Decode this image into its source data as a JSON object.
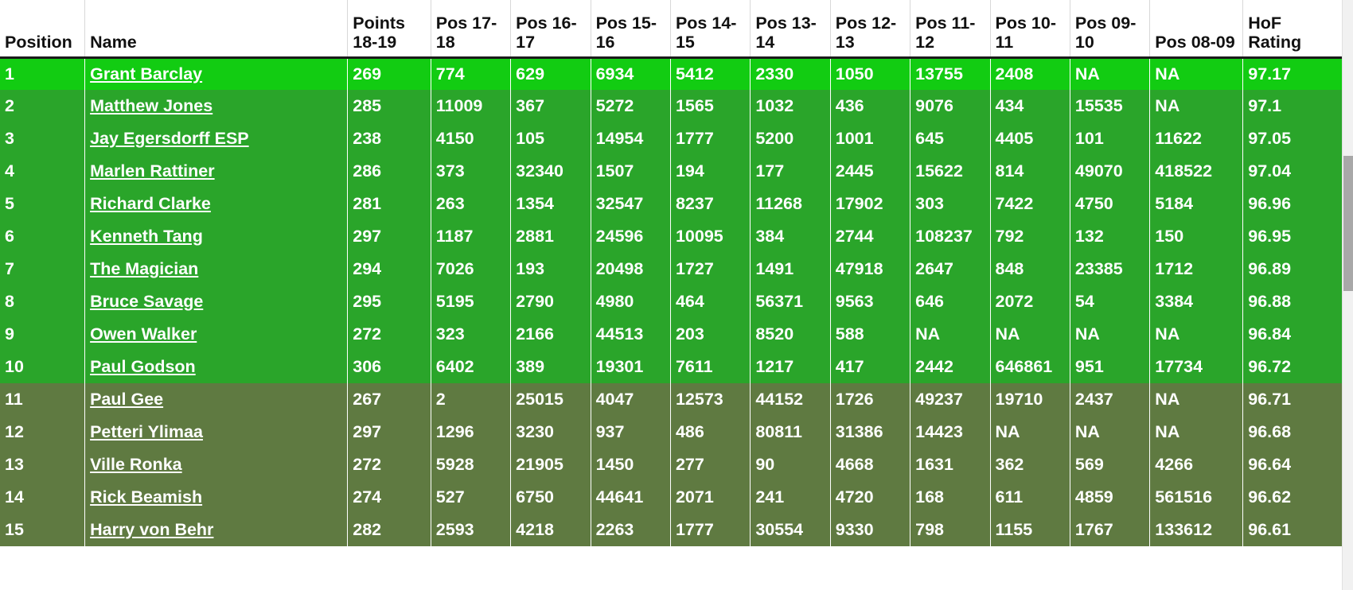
{
  "table": {
    "columns": [
      {
        "key": "position",
        "label": "Position"
      },
      {
        "key": "name",
        "label": "Name"
      },
      {
        "key": "points1819",
        "label": "Points 18-19"
      },
      {
        "key": "pos1718",
        "label": "Pos 17-18"
      },
      {
        "key": "pos1617",
        "label": "Pos 16-17"
      },
      {
        "key": "pos1516",
        "label": "Pos 15-16"
      },
      {
        "key": "pos1415",
        "label": "Pos 14-15"
      },
      {
        "key": "pos1314",
        "label": "Pos 13-14"
      },
      {
        "key": "pos1213",
        "label": "Pos 12-13"
      },
      {
        "key": "pos1112",
        "label": "Pos 11-12"
      },
      {
        "key": "pos1011",
        "label": "Pos 10-11"
      },
      {
        "key": "pos0910",
        "label": "Pos 09-10"
      },
      {
        "key": "pos0809",
        "label": "Pos 08-09"
      },
      {
        "key": "hof",
        "label": "HoF Rating"
      }
    ],
    "rows": [
      {
        "position": "1",
        "name": "Grant Barclay",
        "points1819": "269",
        "pos1718": "774",
        "pos1617": "629",
        "pos1516": "6934",
        "pos1415": "5412",
        "pos1314": "2330",
        "pos1213": "1050",
        "pos1112": "13755",
        "pos1011": "2408",
        "pos0910": "NA",
        "pos0809": "NA",
        "hof": "97.17",
        "tier": "top"
      },
      {
        "position": "2",
        "name": "Matthew Jones",
        "points1819": "285",
        "pos1718": "11009",
        "pos1617": "367",
        "pos1516": "5272",
        "pos1415": "1565",
        "pos1314": "1032",
        "pos1213": "436",
        "pos1112": "9076",
        "pos1011": "434",
        "pos0910": "15535",
        "pos0809": "NA",
        "hof": "97.1",
        "tier": "green"
      },
      {
        "position": "3",
        "name": "Jay Egersdorff ESP",
        "points1819": "238",
        "pos1718": "4150",
        "pos1617": "105",
        "pos1516": "14954",
        "pos1415": "1777",
        "pos1314": "5200",
        "pos1213": "1001",
        "pos1112": "645",
        "pos1011": "4405",
        "pos0910": "101",
        "pos0809": "11622",
        "hof": "97.05",
        "tier": "green"
      },
      {
        "position": "4",
        "name": "Marlen Rattiner",
        "points1819": "286",
        "pos1718": "373",
        "pos1617": "32340",
        "pos1516": "1507",
        "pos1415": "194",
        "pos1314": "177",
        "pos1213": "2445",
        "pos1112": "15622",
        "pos1011": "814",
        "pos0910": "49070",
        "pos0809": "418522",
        "hof": "97.04",
        "tier": "green"
      },
      {
        "position": "5",
        "name": "Richard Clarke",
        "points1819": "281",
        "pos1718": "263",
        "pos1617": "1354",
        "pos1516": "32547",
        "pos1415": "8237",
        "pos1314": "11268",
        "pos1213": "17902",
        "pos1112": "303",
        "pos1011": "7422",
        "pos0910": "4750",
        "pos0809": "5184",
        "hof": "96.96",
        "tier": "green"
      },
      {
        "position": "6",
        "name": "Kenneth Tang",
        "points1819": "297",
        "pos1718": "1187",
        "pos1617": "2881",
        "pos1516": "24596",
        "pos1415": "10095",
        "pos1314": "384",
        "pos1213": "2744",
        "pos1112": "108237",
        "pos1011": "792",
        "pos0910": "132",
        "pos0809": "150",
        "hof": "96.95",
        "tier": "green"
      },
      {
        "position": "7",
        "name": "The Magician",
        "points1819": "294",
        "pos1718": "7026",
        "pos1617": "193",
        "pos1516": "20498",
        "pos1415": "1727",
        "pos1314": "1491",
        "pos1213": "47918",
        "pos1112": "2647",
        "pos1011": "848",
        "pos0910": "23385",
        "pos0809": "1712",
        "hof": "96.89",
        "tier": "green"
      },
      {
        "position": "8",
        "name": "Bruce Savage",
        "points1819": "295",
        "pos1718": "5195",
        "pos1617": "2790",
        "pos1516": "4980",
        "pos1415": "464",
        "pos1314": "56371",
        "pos1213": "9563",
        "pos1112": "646",
        "pos1011": "2072",
        "pos0910": "54",
        "pos0809": "3384",
        "hof": "96.88",
        "tier": "green"
      },
      {
        "position": "9",
        "name": "Owen Walker",
        "points1819": "272",
        "pos1718": "323",
        "pos1617": "2166",
        "pos1516": "44513",
        "pos1415": "203",
        "pos1314": "8520",
        "pos1213": "588",
        "pos1112": "NA",
        "pos1011": "NA",
        "pos0910": "NA",
        "pos0809": "NA",
        "hof": "96.84",
        "tier": "green"
      },
      {
        "position": "10",
        "name": "Paul Godson",
        "points1819": "306",
        "pos1718": "6402",
        "pos1617": "389",
        "pos1516": "19301",
        "pos1415": "7611",
        "pos1314": "1217",
        "pos1213": "417",
        "pos1112": "2442",
        "pos1011": "646861",
        "pos0910": "951",
        "pos0809": "17734",
        "hof": "96.72",
        "tier": "green"
      },
      {
        "position": "11",
        "name": "Paul Gee",
        "points1819": "267",
        "pos1718": "2",
        "pos1617": "25015",
        "pos1516": "4047",
        "pos1415": "12573",
        "pos1314": "44152",
        "pos1213": "1726",
        "pos1112": "49237",
        "pos1011": "19710",
        "pos0910": "2437",
        "pos0809": "NA",
        "hof": "96.71",
        "tier": "olive"
      },
      {
        "position": "12",
        "name": "Petteri Ylimaa",
        "points1819": "297",
        "pos1718": "1296",
        "pos1617": "3230",
        "pos1516": "937",
        "pos1415": "486",
        "pos1314": "80811",
        "pos1213": "31386",
        "pos1112": "14423",
        "pos1011": "NA",
        "pos0910": "NA",
        "pos0809": "NA",
        "hof": "96.68",
        "tier": "olive"
      },
      {
        "position": "13",
        "name": "Ville Ronka",
        "points1819": "272",
        "pos1718": "5928",
        "pos1617": "21905",
        "pos1516": "1450",
        "pos1415": "277",
        "pos1314": "90",
        "pos1213": "4668",
        "pos1112": "1631",
        "pos1011": "362",
        "pos0910": "569",
        "pos0809": "4266",
        "hof": "96.64",
        "tier": "olive"
      },
      {
        "position": "14",
        "name": "Rick Beamish",
        "points1819": "274",
        "pos1718": "527",
        "pos1617": "6750",
        "pos1516": "44641",
        "pos1415": "2071",
        "pos1314": "241",
        "pos1213": "4720",
        "pos1112": "168",
        "pos1011": "611",
        "pos0910": "4859",
        "pos0809": "561516",
        "hof": "96.62",
        "tier": "olive"
      },
      {
        "position": "15",
        "name": "Harry von Behr",
        "points1819": "282",
        "pos1718": "2593",
        "pos1617": "4218",
        "pos1516": "2263",
        "pos1415": "1777",
        "pos1314": "30554",
        "pos1213": "9330",
        "pos1112": "798",
        "pos1011": "1155",
        "pos0910": "1767",
        "pos0809": "133612",
        "hof": "96.61",
        "tier": "olive"
      }
    ]
  },
  "scrollbar": {
    "orientation": "vertical"
  },
  "colors": {
    "tier_top": "#12cc12",
    "tier_green": "#2aa52a",
    "tier_olive": "#5f7a41",
    "header_bg": "#ffffff",
    "header_text": "#111111",
    "cell_text": "#ffffff"
  }
}
